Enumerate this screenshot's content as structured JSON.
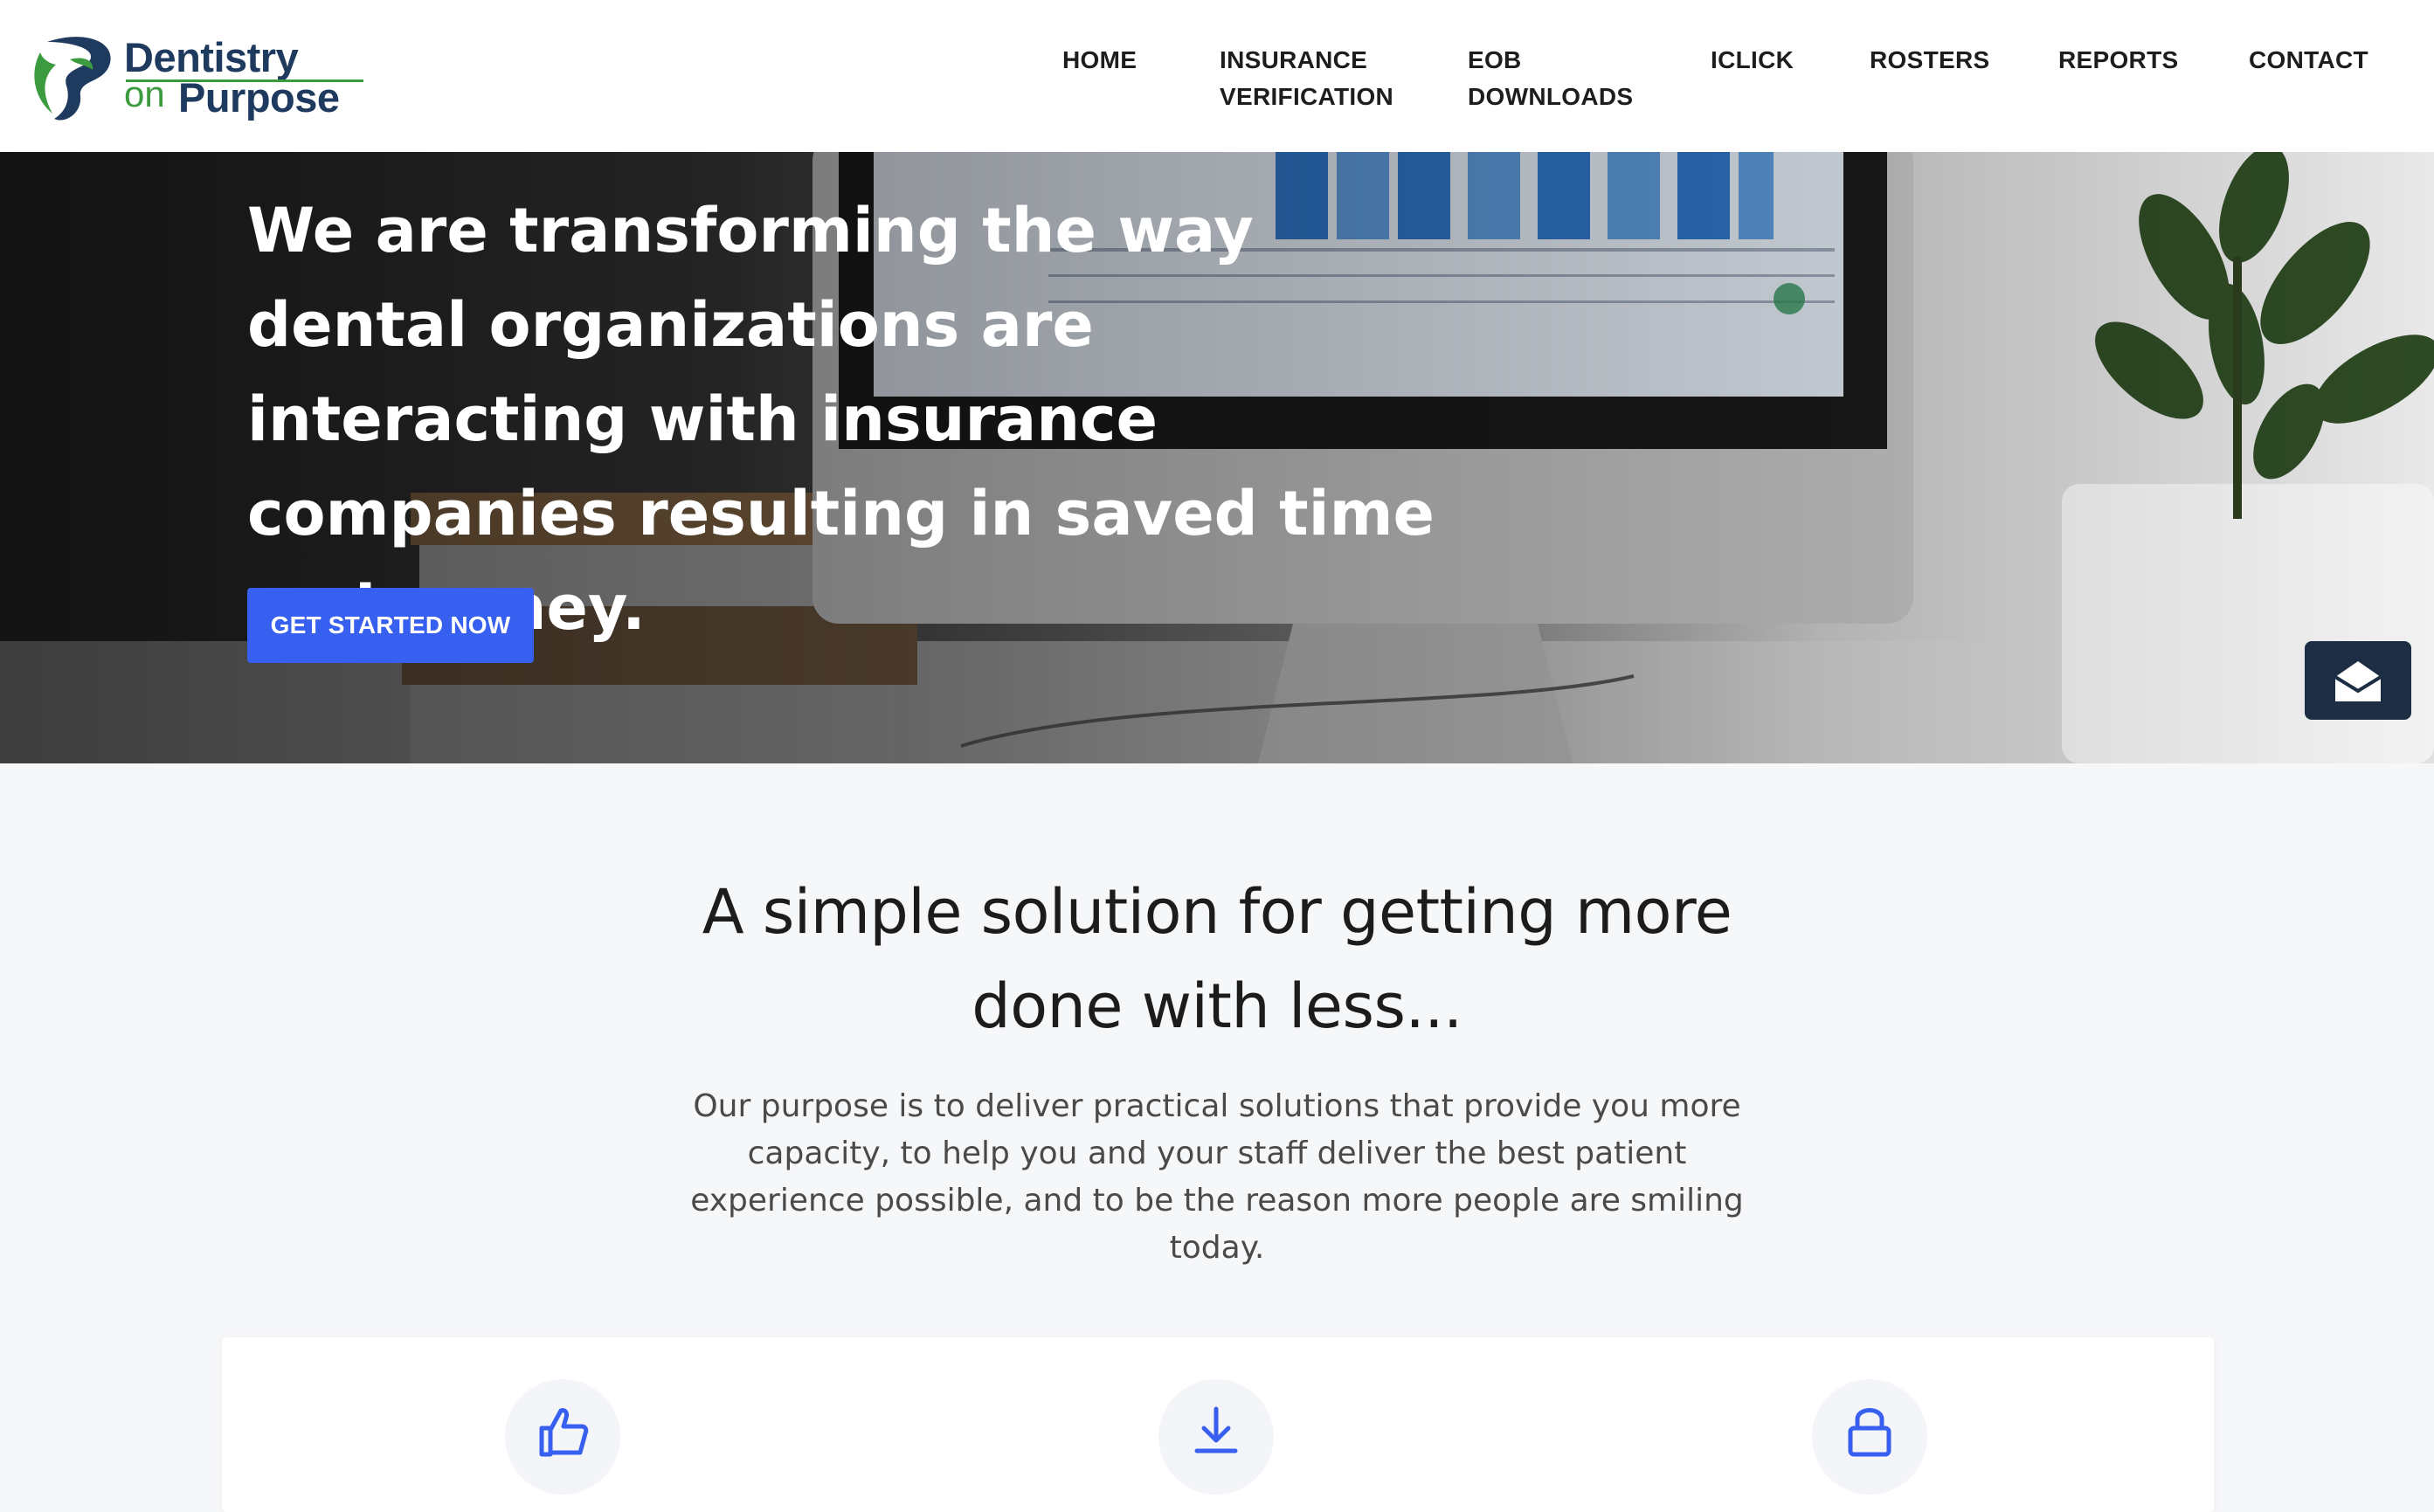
{
  "brand": {
    "logo_line1": "Dentistry",
    "logo_on": "on",
    "logo_line2": "Purpose",
    "colors": {
      "navy": "#1f3a5f",
      "green": "#3c9a3f"
    }
  },
  "nav": {
    "items": [
      {
        "label_lines": [
          "HOME"
        ]
      },
      {
        "label_lines": [
          "INSURANCE",
          "VERIFICATION"
        ]
      },
      {
        "label_lines": [
          "EOB",
          "DOWNLOADS"
        ]
      },
      {
        "label_lines": [
          "ICLICK"
        ]
      },
      {
        "label_lines": [
          "ROSTERS"
        ]
      },
      {
        "label_lines": [
          "REPORTS"
        ]
      },
      {
        "label_lines": [
          "CONTACT"
        ]
      }
    ]
  },
  "hero": {
    "title": "We are transforming the way dental organizations are interacting with insurance companies resulting in saved time and money.",
    "cta_label": "GET STARTED NOW",
    "cta_color": "#3760f0"
  },
  "chat": {
    "icon": "envelope-open-icon",
    "color": "#1c2d44"
  },
  "intro": {
    "title_line1": "A simple solution for getting more",
    "title_line2": "done with less...",
    "body": "Our purpose is to deliver practical solutions that provide you more capacity, to help you and your staff deliver the best patient experience possible, and to be the reason more people are smiling today."
  },
  "features": {
    "icons": [
      "thumbs-up-icon",
      "download-icon",
      "lock-icon"
    ],
    "icon_color": "#3760f0"
  }
}
